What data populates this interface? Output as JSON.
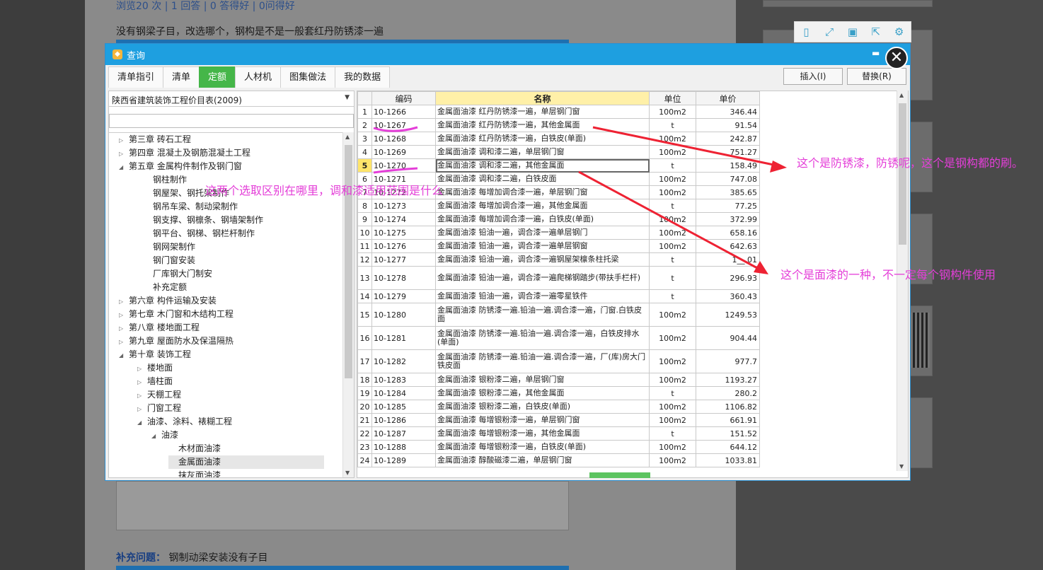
{
  "background": {
    "stats": "浏览20 次 | 1 回答 | 0 答得好 | 0问得好",
    "question": "没有钢梁子目，改选哪个，钢构是不是一般套红丹防锈漆一遍",
    "supplement_label": "补充问题：",
    "supplement_text": "钢制动梁安装没有子目"
  },
  "dialog": {
    "title": "查询",
    "tabs": [
      "清单指引",
      "清单",
      "定额",
      "人材机",
      "图集做法",
      "我的数据"
    ],
    "active_tab": "定额",
    "insert_button": "插入(I)",
    "replace_button": "替换(R)",
    "library_select": "陕西省建筑装饰工程价目表(2009)",
    "tree": [
      {
        "label": "第三章 砖石工程",
        "level": 0,
        "toggle": "closed"
      },
      {
        "label": "第四章 混凝土及钢筋混凝土工程",
        "level": 0,
        "toggle": "closed"
      },
      {
        "label": "第五章 金属构件制作及钢门窗",
        "level": 0,
        "toggle": "open"
      },
      {
        "label": "钢柱制作",
        "level": 1,
        "toggle": "none"
      },
      {
        "label": "钢屋架、钢托架制作",
        "level": 1,
        "toggle": "none"
      },
      {
        "label": "钢吊车梁、制动梁制作",
        "level": 1,
        "toggle": "none"
      },
      {
        "label": "钢支撑、钢檩条、钢墙架制作",
        "level": 1,
        "toggle": "none"
      },
      {
        "label": "钢平台、钢梯、钢栏杆制作",
        "level": 1,
        "toggle": "none"
      },
      {
        "label": "钢网架制作",
        "level": 1,
        "toggle": "none"
      },
      {
        "label": "钢门窗安装",
        "level": 1,
        "toggle": "none"
      },
      {
        "label": "厂库钢大门制安",
        "level": 1,
        "toggle": "none"
      },
      {
        "label": "补充定额",
        "level": 1,
        "toggle": "none"
      },
      {
        "label": "第六章 构件运输及安装",
        "level": 0,
        "toggle": "closed"
      },
      {
        "label": "第七章 木门窗和木结构工程",
        "level": 0,
        "toggle": "closed"
      },
      {
        "label": "第八章 楼地面工程",
        "level": 0,
        "toggle": "closed"
      },
      {
        "label": "第九章 屋面防水及保温隔热",
        "level": 0,
        "toggle": "closed"
      },
      {
        "label": "第十章 装饰工程",
        "level": 0,
        "toggle": "open"
      },
      {
        "label": "楼地面",
        "level": 1,
        "toggle": "closed"
      },
      {
        "label": "墙柱面",
        "level": 1,
        "toggle": "closed"
      },
      {
        "label": "天棚工程",
        "level": 1,
        "toggle": "closed"
      },
      {
        "label": "门窗工程",
        "level": 1,
        "toggle": "closed"
      },
      {
        "label": "油漆、涂料、裱糊工程",
        "level": 1,
        "toggle": "open"
      },
      {
        "label": "油漆",
        "level": 2,
        "toggle": "open"
      },
      {
        "label": "木材面油漆",
        "level": 3,
        "toggle": "none"
      },
      {
        "label": "金属面油漆",
        "level": 3,
        "toggle": "none",
        "selected": true
      },
      {
        "label": "抹灰面油漆",
        "level": 3,
        "toggle": "none"
      }
    ],
    "grid": {
      "headers": [
        "",
        "编码",
        "名称",
        "单位",
        "单价"
      ],
      "rows": [
        [
          "1",
          "10-1266",
          "金属面油漆 红丹防锈漆一遍，单层钢门窗",
          "100m2",
          "346.44"
        ],
        [
          "2",
          "10-1267",
          "金属面油漆 红丹防锈漆一遍，其他金属面",
          "t",
          "91.54"
        ],
        [
          "3",
          "10-1268",
          "金属面油漆 红丹防锈漆一遍，白铁皮(单面)",
          "100m2",
          "242.87"
        ],
        [
          "4",
          "10-1269",
          "金属面油漆 调和漆二遍，单层钢门窗",
          "100m2",
          "751.27"
        ],
        [
          "5",
          "10-1270",
          "金属面油漆 调和漆二遍，其他金属面",
          "t",
          "158.49"
        ],
        [
          "6",
          "10-1271",
          "金属面油漆 调和漆二遍，白铁皮面",
          "100m2",
          "747.08"
        ],
        [
          "7",
          "10-1272",
          "金属面油漆 每增加调合漆一遍，单层钢门窗",
          "100m2",
          "385.65"
        ],
        [
          "8",
          "10-1273",
          "金属面油漆 每增加调合漆一遍，其他金属面",
          "t",
          "77.25"
        ],
        [
          "9",
          "10-1274",
          "金属面油漆 每增加调合漆一遍，白铁皮(单面)",
          "100m2",
          "372.99"
        ],
        [
          "10",
          "10-1275",
          "金属面油漆 铅油一遍，调合漆一遍单层钢门",
          "100m2",
          "658.16"
        ],
        [
          "11",
          "10-1276",
          "金属面油漆 铅油一遍，调合漆一遍单层钢窗",
          "100m2",
          "642.63"
        ],
        [
          "12",
          "10-1277",
          "金属面油漆 铅油一遍，调合漆一遍钢屋架檩条柱托梁",
          "t",
          "1__.01"
        ],
        [
          "13",
          "10-1278",
          "金属面油漆 铅油一遍，调合漆一遍爬梯钢踏步(带扶手栏杆)",
          "t",
          "296.93"
        ],
        [
          "14",
          "10-1279",
          "金属面油漆 铅油一遍，调合漆一遍零星铁件",
          "t",
          "360.43"
        ],
        [
          "15",
          "10-1280",
          "金属面油漆 防锈漆一遍.铅油一遍.调合漆一遍，门窗.白铁皮面",
          "100m2",
          "1249.53"
        ],
        [
          "16",
          "10-1281",
          "金属面油漆 防锈漆一遍.铅油一遍.调合漆一遍，白铁皮排水(单面)",
          "100m2",
          "904.44"
        ],
        [
          "17",
          "10-1282",
          "金属面油漆 防锈漆一遍.铅油一遍.调合漆一遍，厂(库)房大门铁皮面",
          "100m2",
          "977.7"
        ],
        [
          "18",
          "10-1283",
          "金属面油漆 银粉漆二遍，单层钢门窗",
          "100m2",
          "1193.27"
        ],
        [
          "19",
          "10-1284",
          "金属面油漆 银粉漆二遍，其他金属面",
          "t",
          "280.2"
        ],
        [
          "20",
          "10-1285",
          "金属面油漆 银粉漆二遍，白铁皮(单面)",
          "100m2",
          "1106.82"
        ],
        [
          "21",
          "10-1286",
          "金属面油漆 每增银粉漆一遍，单层钢门窗",
          "100m2",
          "661.91"
        ],
        [
          "22",
          "10-1287",
          "金属面油漆 每增银粉漆一遍，其他金属面",
          "t",
          "151.52"
        ],
        [
          "23",
          "10-1288",
          "金属面油漆 每增银粉漆一遍，白铁皮(单面)",
          "100m2",
          "644.12"
        ],
        [
          "24",
          "10-1289",
          "金属面油漆 醇酸磁漆二遍，单层钢门窗",
          "100m2",
          "1033.81"
        ]
      ],
      "selected_row": 5
    }
  },
  "annotations": {
    "left_question": "这两个选取区别在哪里，调和漆适用范围是什么",
    "right_top": "这个是防锈漆，防锈呢，这个是钢构都的刷。",
    "right_bottom": "这个是面漆的一种，不一定每个钢构件使用",
    "color": "#e43ed8"
  },
  "colors": {
    "titlebar": "#1e9fe0",
    "active_tab": "#45b649",
    "header_highlight": "#fff0a8",
    "annotation_arrow": "#ee2233"
  }
}
